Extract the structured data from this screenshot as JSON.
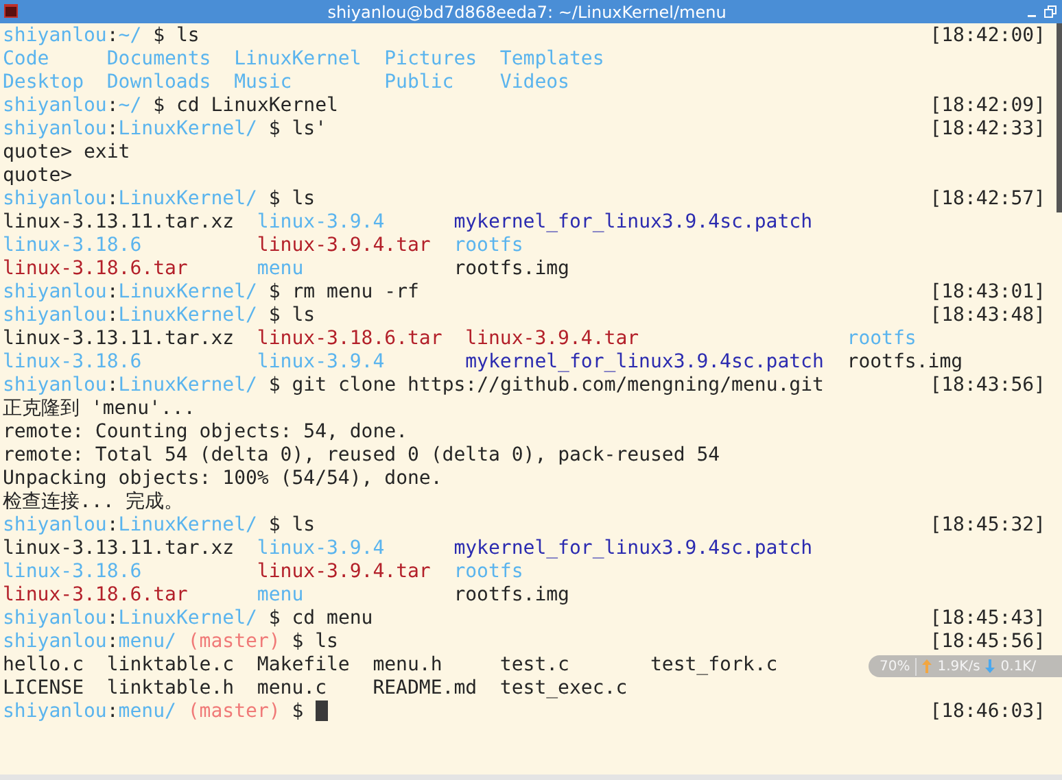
{
  "window": {
    "title": "shiyanlou@bd7d868eeda7: ~/LinuxKernel/menu"
  },
  "lines": [
    {
      "kind": "text",
      "segments": [
        {
          "text": "shiyanlou",
          "kind": "host"
        },
        {
          "text": ":",
          "kind": "plain"
        },
        {
          "text": "~/",
          "kind": "path"
        },
        {
          "text": " $ ls",
          "kind": "plain"
        }
      ],
      "time": "[18:42:00]"
    },
    {
      "kind": "listing",
      "rows": [
        [
          {
            "text": "Code",
            "kind": "dir"
          },
          {
            "text": "Documents",
            "kind": "dir"
          },
          {
            "text": "LinuxKernel",
            "kind": "dir"
          },
          {
            "text": "Pictures",
            "kind": "dir"
          },
          {
            "text": "Templates",
            "kind": "dir"
          }
        ],
        [
          {
            "text": "Desktop",
            "kind": "dir"
          },
          {
            "text": "Downloads",
            "kind": "dir"
          },
          {
            "text": "Music",
            "kind": "dir"
          },
          {
            "text": "Public",
            "kind": "dir"
          },
          {
            "text": "Videos",
            "kind": "dir"
          }
        ]
      ]
    },
    {
      "kind": "text",
      "segments": [
        {
          "text": "shiyanlou",
          "kind": "host"
        },
        {
          "text": ":",
          "kind": "plain"
        },
        {
          "text": "~/",
          "kind": "path"
        },
        {
          "text": " $ cd LinuxKernel",
          "kind": "plain"
        }
      ],
      "time": "[18:42:09]"
    },
    {
      "kind": "text",
      "segments": [
        {
          "text": "shiyanlou",
          "kind": "host"
        },
        {
          "text": ":",
          "kind": "plain"
        },
        {
          "text": "LinuxKernel/",
          "kind": "path"
        },
        {
          "text": " $ ls'",
          "kind": "plain"
        }
      ],
      "time": "[18:42:33]"
    },
    {
      "kind": "text",
      "segments": [
        {
          "text": "quote> exit",
          "kind": "plain"
        }
      ]
    },
    {
      "kind": "text",
      "segments": [
        {
          "text": "quote>",
          "kind": "plain"
        }
      ]
    },
    {
      "kind": "text",
      "segments": [
        {
          "text": "shiyanlou",
          "kind": "host"
        },
        {
          "text": ":",
          "kind": "plain"
        },
        {
          "text": "LinuxKernel/",
          "kind": "path"
        },
        {
          "text": " $ ls",
          "kind": "plain"
        }
      ],
      "time": "[18:42:57]"
    },
    {
      "kind": "listing",
      "rows": [
        [
          {
            "text": "linux-3.13.11.tar.xz",
            "kind": "plain"
          },
          {
            "text": "linux-3.9.4",
            "kind": "dir"
          },
          {
            "text": "mykernel_for_linux3.9.4sc.patch",
            "kind": "patch"
          }
        ],
        [
          {
            "text": "linux-3.18.6",
            "kind": "dir"
          },
          {
            "text": "linux-3.9.4.tar",
            "kind": "archive"
          },
          {
            "text": "rootfs",
            "kind": "dir"
          }
        ],
        [
          {
            "text": "linux-3.18.6.tar",
            "kind": "archive"
          },
          {
            "text": "menu",
            "kind": "dir"
          },
          {
            "text": "rootfs.img",
            "kind": "plain"
          }
        ]
      ]
    },
    {
      "kind": "text",
      "segments": [
        {
          "text": "shiyanlou",
          "kind": "host"
        },
        {
          "text": ":",
          "kind": "plain"
        },
        {
          "text": "LinuxKernel/",
          "kind": "path"
        },
        {
          "text": " $ rm menu -rf",
          "kind": "plain"
        }
      ],
      "time": "[18:43:01]"
    },
    {
      "kind": "text",
      "segments": [
        {
          "text": "shiyanlou",
          "kind": "host"
        },
        {
          "text": ":",
          "kind": "plain"
        },
        {
          "text": "LinuxKernel/",
          "kind": "path"
        },
        {
          "text": " $ ls",
          "kind": "plain"
        }
      ],
      "time": "[18:43:48]"
    },
    {
      "kind": "listing",
      "rows": [
        [
          {
            "text": "linux-3.13.11.tar.xz",
            "kind": "plain"
          },
          {
            "text": "linux-3.18.6.tar",
            "kind": "archive"
          },
          {
            "text": "linux-3.9.4.tar",
            "kind": "archive"
          },
          {
            "text": "rootfs",
            "kind": "dir"
          }
        ],
        [
          {
            "text": "linux-3.18.6",
            "kind": "dir"
          },
          {
            "text": "linux-3.9.4",
            "kind": "dir"
          },
          {
            "text": "mykernel_for_linux3.9.4sc.patch",
            "kind": "patch"
          },
          {
            "text": "rootfs.img",
            "kind": "plain"
          }
        ]
      ]
    },
    {
      "kind": "text",
      "segments": [
        {
          "text": "shiyanlou",
          "kind": "host"
        },
        {
          "text": ":",
          "kind": "plain"
        },
        {
          "text": "LinuxKernel/",
          "kind": "path"
        },
        {
          "text": " $ git clone https://github.com/mengning/menu.git",
          "kind": "plain"
        }
      ],
      "time": "[18:43:56]"
    },
    {
      "kind": "text",
      "segments": [
        {
          "text": "正克隆到 'menu'...",
          "kind": "plain"
        }
      ]
    },
    {
      "kind": "text",
      "segments": [
        {
          "text": "remote: Counting objects: 54, done.",
          "kind": "plain"
        }
      ]
    },
    {
      "kind": "text",
      "segments": [
        {
          "text": "remote: Total 54 (delta 0), reused 0 (delta 0), pack-reused 54",
          "kind": "plain"
        }
      ]
    },
    {
      "kind": "text",
      "segments": [
        {
          "text": "Unpacking objects: 100% (54/54), done.",
          "kind": "plain"
        }
      ]
    },
    {
      "kind": "text",
      "segments": [
        {
          "text": "检查连接... 完成。",
          "kind": "plain"
        }
      ]
    },
    {
      "kind": "text",
      "segments": [
        {
          "text": "shiyanlou",
          "kind": "host"
        },
        {
          "text": ":",
          "kind": "plain"
        },
        {
          "text": "LinuxKernel/",
          "kind": "path"
        },
        {
          "text": " $ ls",
          "kind": "plain"
        }
      ],
      "time": "[18:45:32]"
    },
    {
      "kind": "listing",
      "rows": [
        [
          {
            "text": "linux-3.13.11.tar.xz",
            "kind": "plain"
          },
          {
            "text": "linux-3.9.4",
            "kind": "dir"
          },
          {
            "text": "mykernel_for_linux3.9.4sc.patch",
            "kind": "patch"
          }
        ],
        [
          {
            "text": "linux-3.18.6",
            "kind": "dir"
          },
          {
            "text": "linux-3.9.4.tar",
            "kind": "archive"
          },
          {
            "text": "rootfs",
            "kind": "dir"
          }
        ],
        [
          {
            "text": "linux-3.18.6.tar",
            "kind": "archive"
          },
          {
            "text": "menu",
            "kind": "dir"
          },
          {
            "text": "rootfs.img",
            "kind": "plain"
          }
        ]
      ]
    },
    {
      "kind": "text",
      "segments": [
        {
          "text": "shiyanlou",
          "kind": "host"
        },
        {
          "text": ":",
          "kind": "plain"
        },
        {
          "text": "LinuxKernel/",
          "kind": "path"
        },
        {
          "text": " $ cd menu",
          "kind": "plain"
        }
      ],
      "time": "[18:45:43]"
    },
    {
      "kind": "text",
      "segments": [
        {
          "text": "shiyanlou",
          "kind": "host"
        },
        {
          "text": ":",
          "kind": "plain"
        },
        {
          "text": "menu/",
          "kind": "path"
        },
        {
          "text": " (master)",
          "kind": "branch"
        },
        {
          "text": " $ ls",
          "kind": "plain"
        }
      ],
      "time": "[18:45:56]"
    },
    {
      "kind": "listing",
      "rows": [
        [
          {
            "text": "hello.c",
            "kind": "plain"
          },
          {
            "text": "linktable.c",
            "kind": "plain"
          },
          {
            "text": "Makefile",
            "kind": "plain"
          },
          {
            "text": "menu.h",
            "kind": "plain"
          },
          {
            "text": "test.c",
            "kind": "plain"
          },
          {
            "text": "test_fork.c",
            "kind": "plain"
          }
        ],
        [
          {
            "text": "LICENSE",
            "kind": "plain"
          },
          {
            "text": "linktable.h",
            "kind": "plain"
          },
          {
            "text": "menu.c",
            "kind": "plain"
          },
          {
            "text": "README.md",
            "kind": "plain"
          },
          {
            "text": "test_exec.c",
            "kind": "plain"
          }
        ]
      ]
    },
    {
      "kind": "text",
      "segments": [
        {
          "text": "shiyanlou",
          "kind": "host"
        },
        {
          "text": ":",
          "kind": "plain"
        },
        {
          "text": "menu/",
          "kind": "path"
        },
        {
          "text": " (master)",
          "kind": "branch"
        },
        {
          "text": " $",
          "kind": "plain"
        }
      ],
      "time": "[18:46:03]",
      "cursor": true
    }
  ],
  "net_widget": {
    "battery": "70%",
    "upload": "1.9K/s",
    "download": "0.1K/"
  }
}
